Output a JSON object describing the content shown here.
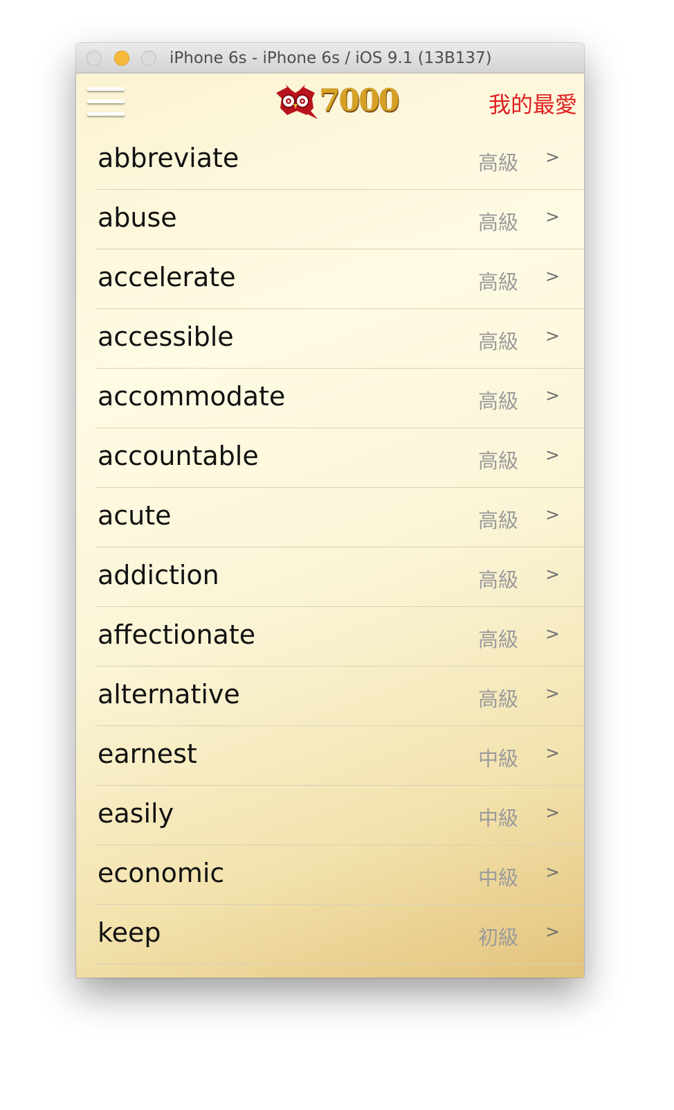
{
  "window": {
    "title": "iPhone 6s - iPhone 6s / iOS 9.1 (13B137)"
  },
  "navbar": {
    "menu_icon": "hamburger-menu-icon",
    "logo_icon": "owl-icon",
    "logo_text": "7000",
    "favorites_label": "我的最愛"
  },
  "colors": {
    "accent_red": "#e02020",
    "logo_gold": "#d6a125",
    "level_gray": "#9b9b9b"
  },
  "words": [
    {
      "word": "abbreviate",
      "level": "高級",
      "chevron": ">"
    },
    {
      "word": "abuse",
      "level": "高級",
      "chevron": ">"
    },
    {
      "word": "accelerate",
      "level": "高級",
      "chevron": ">"
    },
    {
      "word": "accessible",
      "level": "高級",
      "chevron": ">"
    },
    {
      "word": "accommodate",
      "level": "高級",
      "chevron": ">"
    },
    {
      "word": "accountable",
      "level": "高級",
      "chevron": ">"
    },
    {
      "word": "acute",
      "level": "高級",
      "chevron": ">"
    },
    {
      "word": "addiction",
      "level": "高級",
      "chevron": ">"
    },
    {
      "word": "affectionate",
      "level": "高級",
      "chevron": ">"
    },
    {
      "word": "alternative",
      "level": "高級",
      "chevron": ">"
    },
    {
      "word": "earnest",
      "level": "中級",
      "chevron": ">"
    },
    {
      "word": "easily",
      "level": "中級",
      "chevron": ">"
    },
    {
      "word": "economic",
      "level": "中級",
      "chevron": ">"
    },
    {
      "word": "keep",
      "level": "初級",
      "chevron": ">"
    }
  ]
}
